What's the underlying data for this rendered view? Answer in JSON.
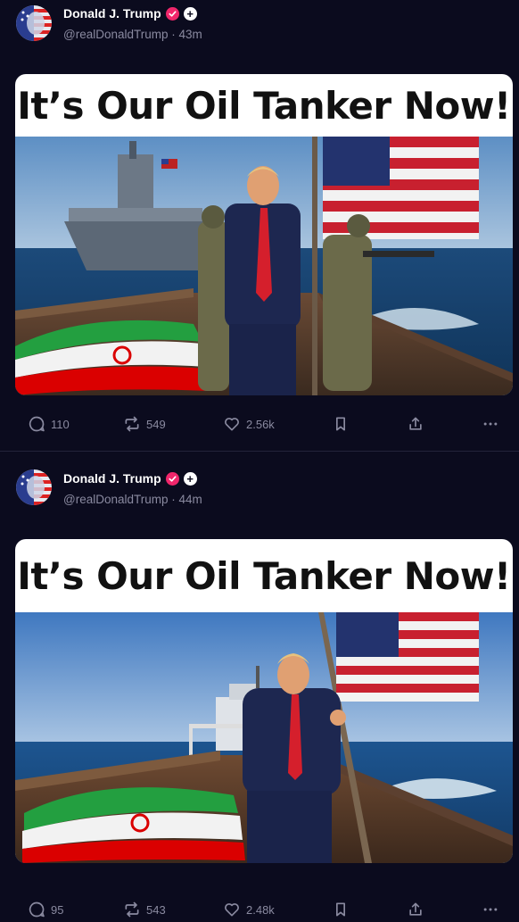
{
  "posts": [
    {
      "author": {
        "display_name": "Donald J. Trump",
        "handle": "@realDonaldTrump",
        "time": "43m",
        "verified": true,
        "avatar_icon": "avatar-flag-portrait"
      },
      "media": {
        "caption": "It’s Our Oil Tanker Now!"
      },
      "actions": {
        "replies": "110",
        "retruths": "549",
        "likes": "2.56k"
      }
    },
    {
      "author": {
        "display_name": "Donald J. Trump",
        "handle": "@realDonaldTrump",
        "time": "44m",
        "verified": true,
        "avatar_icon": "avatar-flag-portrait"
      },
      "media": {
        "caption": "It’s Our Oil Tanker Now!"
      },
      "actions": {
        "replies": "95",
        "retruths": "543",
        "likes": "2.48k"
      }
    }
  ],
  "meta_separator": " · ",
  "colors": {
    "background": "#0b0b1e",
    "verified": "#f0266b",
    "muted": "#8a8aa0"
  }
}
